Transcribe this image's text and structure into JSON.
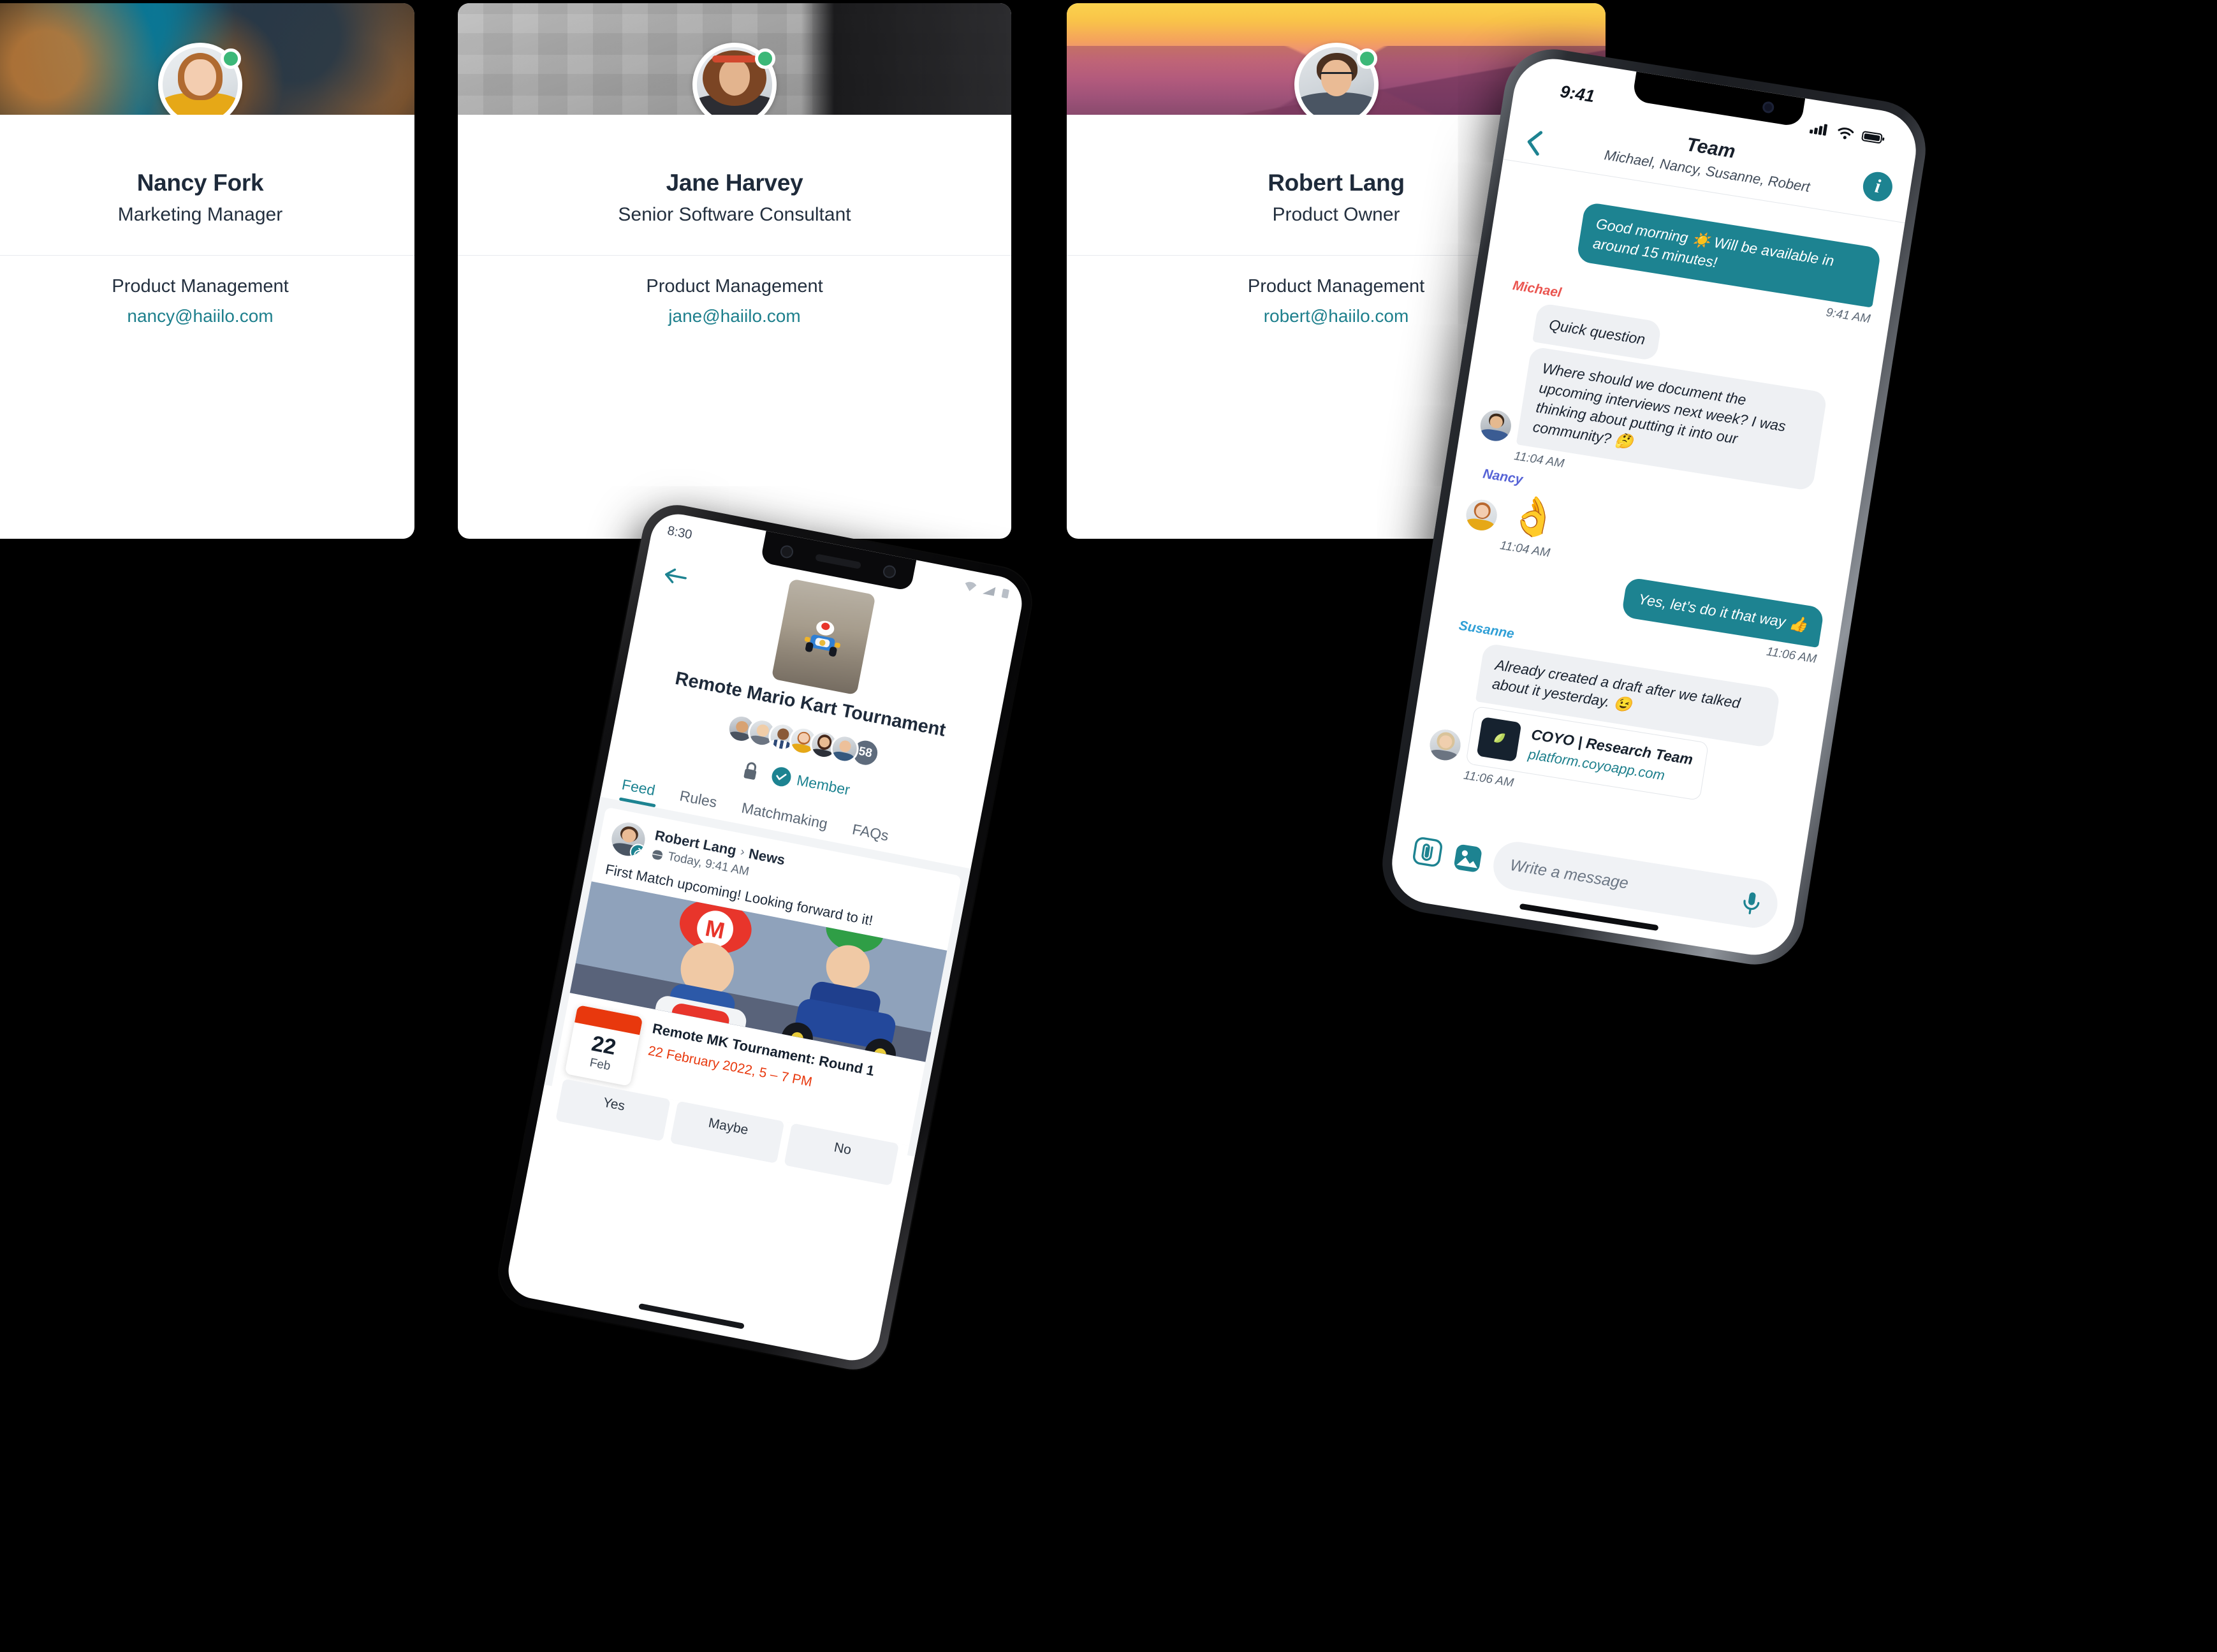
{
  "theme": {
    "accent": "#1d8391",
    "online": "#3cb878",
    "danger": "#e8380d",
    "dark_text": "#1e2a3a"
  },
  "profile_cards": [
    {
      "name": "Nancy Fork",
      "role": "Marketing Manager",
      "department": "Product Management",
      "email": "nancy@haiilo.com",
      "status": "online"
    },
    {
      "name": "Jane Harvey",
      "role": "Senior Software Consultant",
      "department": "Product Management",
      "email": "jane@haiilo.com",
      "status": "online"
    },
    {
      "name": "Robert Lang",
      "role": "Product Owner",
      "department": "Product Management",
      "email": "robert@haiilo.com",
      "status": "online"
    }
  ],
  "android": {
    "status_bar": {
      "time": "8:30",
      "icons": [
        "wifi-icon",
        "signal-icon",
        "battery-icon"
      ]
    },
    "back_icon": "back-arrow-icon",
    "community": {
      "title": "Remote Mario Kart Tournament",
      "member_overflow_count": "58",
      "lock_icon": "lock-icon",
      "membership_label": "Member",
      "membership_icon": "check-circle-icon"
    },
    "tabs": [
      {
        "label": "Feed",
        "active": true
      },
      {
        "label": "Rules",
        "active": false
      },
      {
        "label": "Matchmaking",
        "active": false
      },
      {
        "label": "FAQs",
        "active": false
      }
    ],
    "post": {
      "author": "Robert Lang",
      "separator": "›",
      "category": "News",
      "timestamp": "Today, 9:41 AM",
      "time_icon": "globe-icon",
      "share_icon": "share-icon",
      "text": "First Match upcoming! Looking forward to it!"
    },
    "event": {
      "day": "22",
      "month": "Feb",
      "title": "Remote MK Tournament: Round 1",
      "date": "22 February 2022, 5 – 7 PM",
      "rsvp": [
        "Yes",
        "Maybe",
        "No"
      ]
    }
  },
  "iphone": {
    "status_bar": {
      "time": "9:41",
      "icons": [
        "signal-icon",
        "wifi-icon",
        "battery-icon"
      ]
    },
    "header": {
      "back_icon": "back-chevron-icon",
      "title": "Team",
      "subtitle": "Michael, Nancy, Susanne, Robert",
      "info_icon": "info-icon",
      "info_label": "i"
    },
    "messages": [
      {
        "direction": "out",
        "text": "Good morning ☀️ Will be available in around 15 minutes!",
        "time": "9:41 AM"
      },
      {
        "direction": "in",
        "sender": "Michael",
        "sender_color": "#ea5550",
        "bubbles": [
          "Quick question",
          "Where should we document the upcoming interviews next week? I was thinking about putting it into our community? 🤔"
        ],
        "time": "11:04 AM"
      },
      {
        "direction": "in",
        "sender": "Nancy",
        "sender_color": "#5663d6",
        "emoji": "👌",
        "time": "11:04 AM"
      },
      {
        "direction": "out",
        "text": "Yes, let’s do it that way 👍",
        "time": "11:06 AM"
      },
      {
        "direction": "in",
        "sender": "Susanne",
        "sender_color": "#2f9fd6",
        "bubbles": [
          "Already created a draft after we talked about it yesterday. 😉"
        ],
        "link_preview": {
          "title": "COYO | Research Team",
          "url": "platform.coyoapp.com",
          "icon": "coyo-logo-icon"
        },
        "time": "11:06 AM"
      }
    ],
    "composer": {
      "attach_icon": "paperclip-icon",
      "image_icon": "image-icon",
      "placeholder": "Write a message",
      "mic_icon": "microphone-icon"
    }
  }
}
